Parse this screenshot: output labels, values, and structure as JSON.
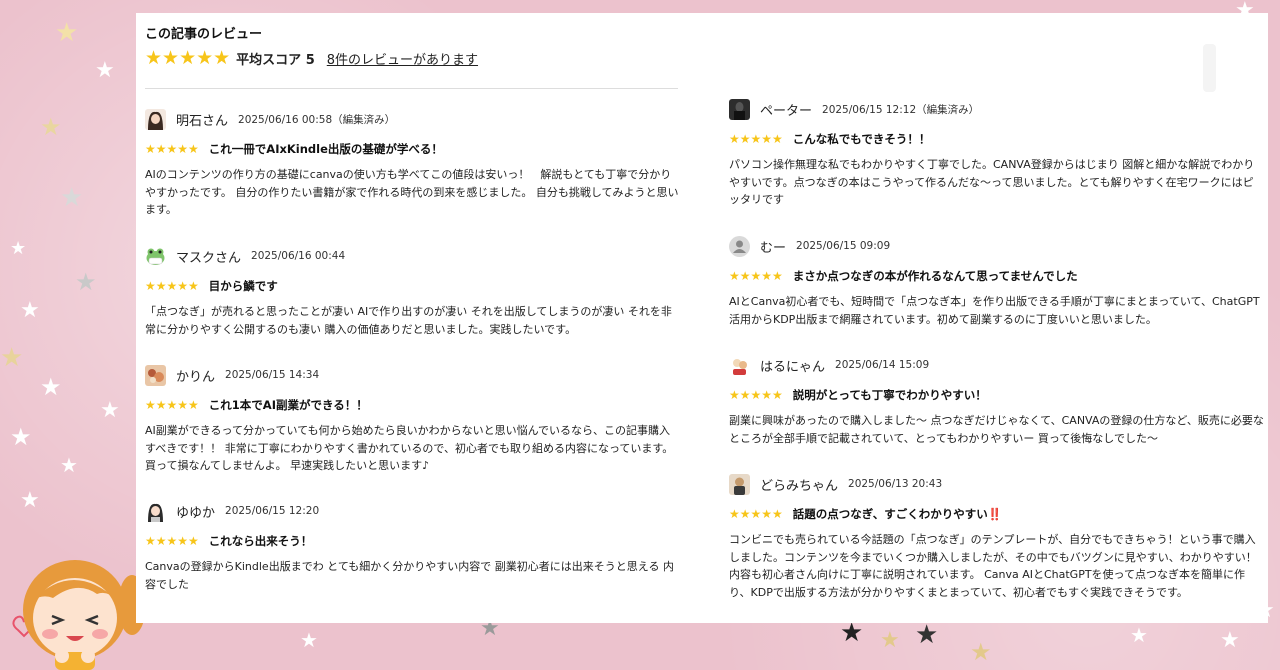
{
  "header": {
    "title": "この記事のレビュー",
    "stars": "★★★★★",
    "average": "平均スコア 5",
    "count_link": "8件のレビューがあります"
  },
  "reviews_left": [
    {
      "name": "明石さん",
      "date": "2025/06/16 00:58（編集済み）",
      "stars": "★★★★★",
      "title": "これ一冊でAIxKindle出版の基礎が学べる！",
      "body": "AIのコンテンツの作り方の基礎にcanvaの使い方も学べてこの値段は安いっ！　解説もとても丁寧で分かりやすかったです。 自分の作りたい書籍が家で作れる時代の到来を感じました。 自分も挑戦してみようと思います。"
    },
    {
      "name": "マスクさん",
      "date": "2025/06/16 00:44",
      "stars": "★★★★★",
      "title": "目から鱗です",
      "body": "「点つなぎ」が売れると思ったことが凄い AIで作り出すのが凄い それを出版してしまうのが凄い それを非常に分かりやすく公開するのも凄い 購入の価値ありだと思いました。実践したいです。"
    },
    {
      "name": "かりん",
      "date": "2025/06/15 14:34",
      "stars": "★★★★★",
      "title": "これ1本でAI副業ができる！！",
      "body": "AI副業ができるって分かっていても何から始めたら良いかわからないと思い悩んでいるなら、この記事購入すべきです！！ 非常に丁寧にわかりやすく書かれているので、初心者でも取り組める内容になっています。 買って損なんてしませんよ。 早速実践したいと思います♪"
    },
    {
      "name": "ゆゆか",
      "date": "2025/06/15 12:20",
      "stars": "★★★★★",
      "title": "これなら出来そう！",
      "body": "Canvaの登録からKindle出版までわ とても細かく分かりやすい内容で 副業初心者には出来そうと思える 内容でした"
    }
  ],
  "reviews_right": [
    {
      "name": "ペーター",
      "date": "2025/06/15 12:12（編集済み）",
      "stars": "★★★★★",
      "title": "こんな私でもできそう！！",
      "body": "パソコン操作無理な私でもわかりやすく丁寧でした。CANVA登録からはじまり 図解と細かな解説でわかりやすいです。点つなぎの本はこうやって作るんだな〜って思いました。とても解りやすく在宅ワークにはピッタリです"
    },
    {
      "name": "むー",
      "date": "2025/06/15 09:09",
      "stars": "★★★★★",
      "title": "まさか点つなぎの本が作れるなんて思ってませんでした",
      "body": "AIとCanva初心者でも、短時間で「点つなぎ本」を作り出版できる手順が丁寧にまとまっていて、ChatGPT活用からKDP出版まで網羅されています。初めて副業するのに丁度いいと思いました。"
    },
    {
      "name": "はるにゃん",
      "date": "2025/06/14 15:09",
      "stars": "★★★★★",
      "title": "説明がとっても丁寧でわかりやすい！",
      "body": "副業に興味があったので購入しました〜 点つなぎだけじゃなくて、CANVAの登録の仕方など、販売に必要なところが全部手順で記載されていて、とってもわかりやすいー 買って後悔なしでした〜"
    },
    {
      "name": "どらみちゃん",
      "date": "2025/06/13 20:43",
      "stars": "★★★★★",
      "title": "話題の点つなぎ、すごくわかりやすい‼️",
      "body": "コンビニでも売られている今話題の「点つなぎ」のテンプレートが、自分でもできちゃう！という事で購入しました。コンテンツを今までいくつか購入しましたが、その中でもバツグンに見やすい、わかりやすい！ 内容も初心者さん向けに丁寧に説明されています。 Canva AIとChatGPTを使って点つなぎ本を簡単に作り、KDPで出版する方法が分かりやすくまとまっていて、初心者でもすぐ実践できそうです。"
    }
  ],
  "colors": {
    "star": "#f7c51a",
    "background": "#ecc2cd",
    "panel": "#ffffff"
  }
}
